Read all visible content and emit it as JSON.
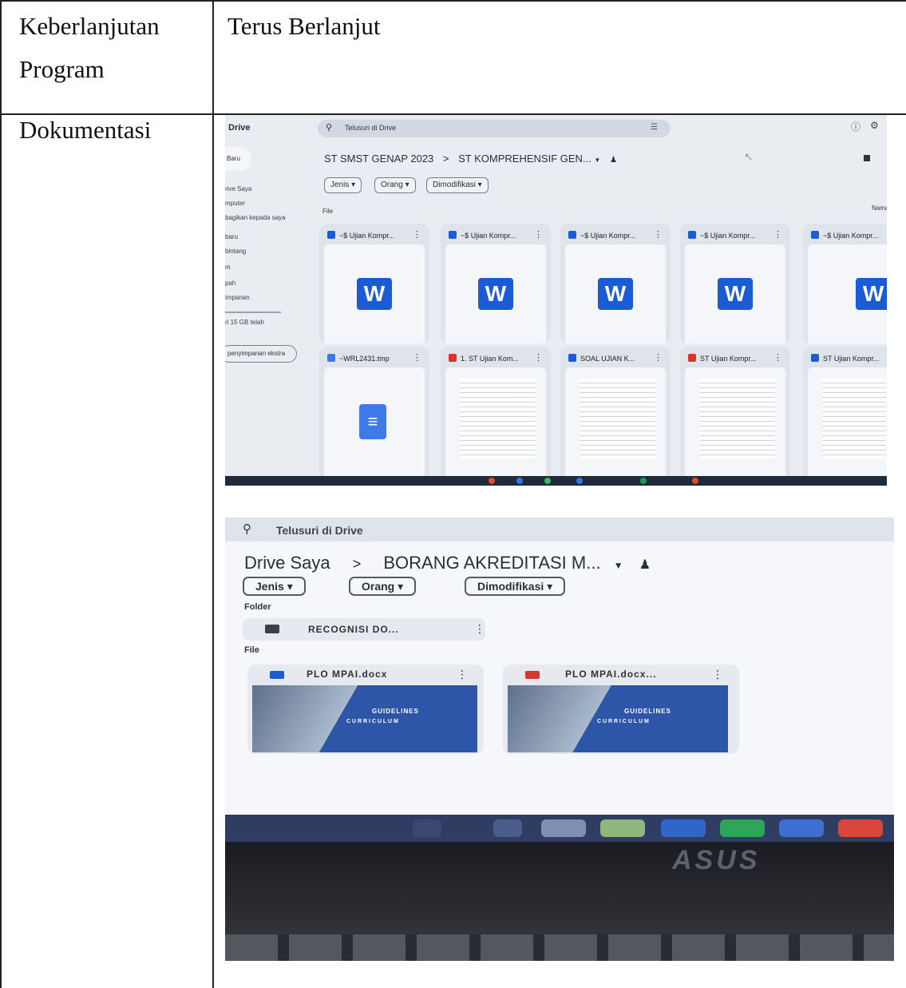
{
  "table": {
    "row1": {
      "label_line1": "Keberlanjutan",
      "label_line2": "Program",
      "value": "Terus Berlanjut"
    },
    "row2": {
      "label": "Dokumentasi"
    }
  },
  "photo1": {
    "app": "Drive",
    "search_placeholder": "Telusuri di Drive",
    "new_button": "Baru",
    "sidebar": [
      "rive Saya",
      "mputer",
      "bagikan kepada saya",
      "baru",
      "bintang",
      "m",
      "pah",
      "impanan",
      "ri 15 GB telah"
    ],
    "storage_button": "penyimpanan ekstra",
    "breadcrumb_root": "ST SMST GENAP 2023",
    "breadcrumb_sep": ">",
    "breadcrumb_current": "ST KOMPREHENSIF GEN...",
    "filters": [
      "Jenis",
      "Orang",
      "Dimodifikasi"
    ],
    "section_files": "File",
    "right_label": "Nama",
    "row1_files": [
      "~$ Ujian Kompr...",
      "~$ Ujian Kompr...",
      "~$ Ujian Kompr...",
      "~$ Ujian Kompr...",
      "~$ Ujian Kompr..."
    ],
    "row2_files": [
      "~WRL2431.tmp",
      "1. ST Ujian Kom...",
      "SOAL UJIAN K...",
      "ST Ujian Kompr...",
      "ST Ujian Kompr..."
    ],
    "word_glyph": "W"
  },
  "photo2": {
    "search_placeholder": "Telusuri di Drive",
    "breadcrumb_root": "Drive Saya",
    "breadcrumb_sep": ">",
    "breadcrumb_current": "BORANG AKREDITASI M...",
    "filters": [
      "Jenis",
      "Orang",
      "Dimodifikasi"
    ],
    "section_folder": "Folder",
    "folder_name": "RECOGNISI DO...",
    "section_files": "File",
    "files": [
      {
        "name": "PLO MPAI.docx",
        "icon": "W",
        "title": "GUIDELINES",
        "subtitle": "C U R R I C U L U M"
      },
      {
        "name": "PLO MPAI.docx...",
        "icon": "PDF",
        "title": "GUIDELINES",
        "subtitle": "C U R R I C U L U M"
      }
    ],
    "brand": "ASUS"
  },
  "colors": {
    "word_blue": "#1b5bd4",
    "pdf_red": "#d9352b",
    "guideline_blue": "#2d55a8"
  }
}
